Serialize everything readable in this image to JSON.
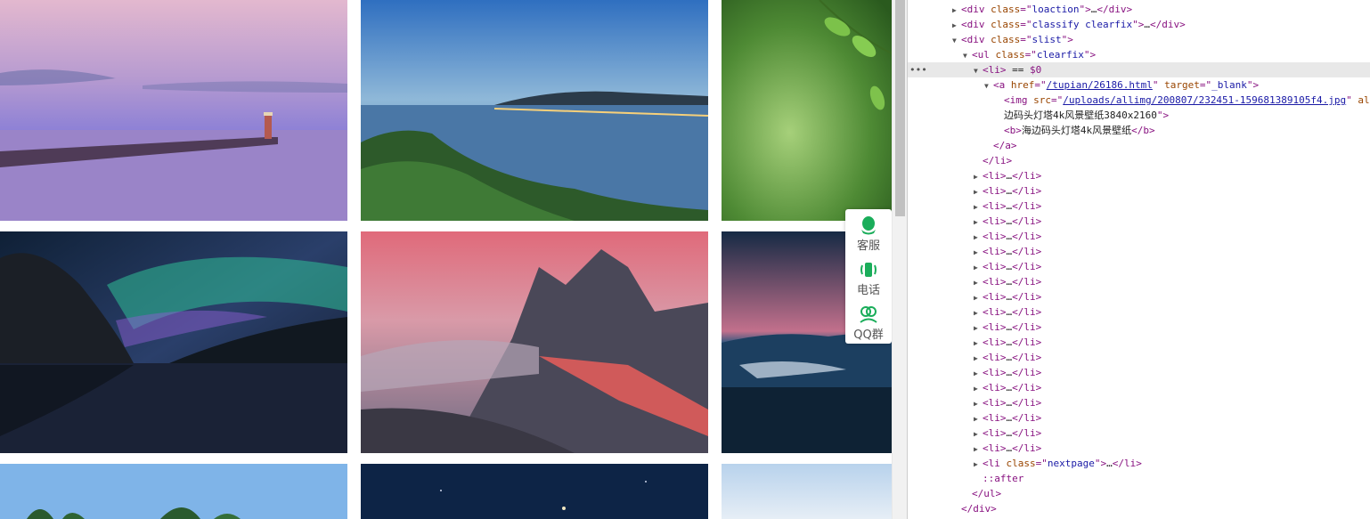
{
  "floating_panel": {
    "items": [
      {
        "label": "客服",
        "icon": "qq-penguin-icon"
      },
      {
        "label": "电话",
        "icon": "phone-icon"
      },
      {
        "label": "QQ群",
        "icon": "qq-group-icon"
      }
    ],
    "accent": "#1aad5a"
  },
  "devtools": {
    "lines": [
      {
        "indent": 4,
        "tri": "▶",
        "parts": [
          [
            "tg",
            "<div "
          ],
          [
            "an",
            "class"
          ],
          [
            "tg",
            "=\""
          ],
          [
            "av",
            "loaction"
          ],
          [
            "tg",
            "\">"
          ],
          [
            "tx",
            "…"
          ],
          [
            "tg",
            "</div>"
          ]
        ]
      },
      {
        "indent": 4,
        "tri": "▶",
        "parts": [
          [
            "tg",
            "<div "
          ],
          [
            "an",
            "class"
          ],
          [
            "tg",
            "=\""
          ],
          [
            "av",
            "classify clearfix"
          ],
          [
            "tg",
            "\">"
          ],
          [
            "tx",
            "…"
          ],
          [
            "tg",
            "</div>"
          ]
        ]
      },
      {
        "indent": 4,
        "tri": "▼",
        "parts": [
          [
            "tg",
            "<div "
          ],
          [
            "an",
            "class"
          ],
          [
            "tg",
            "=\""
          ],
          [
            "av",
            "slist"
          ],
          [
            "tg",
            "\">"
          ]
        ]
      },
      {
        "indent": 5,
        "tri": "▼",
        "parts": [
          [
            "tg",
            "<ul "
          ],
          [
            "an",
            "class"
          ],
          [
            "tg",
            "=\""
          ],
          [
            "av",
            "clearfix"
          ],
          [
            "tg",
            "\">"
          ]
        ]
      },
      {
        "indent": 6,
        "tri": "▼",
        "sel": true,
        "parts": [
          [
            "tg",
            "<li>"
          ],
          [
            "tx",
            " == "
          ],
          [
            "ps",
            "$0"
          ]
        ]
      },
      {
        "indent": 7,
        "tri": "▼",
        "parts": [
          [
            "tg",
            "<a "
          ],
          [
            "an",
            "href"
          ],
          [
            "tg",
            "=\""
          ],
          [
            "lk",
            "/tupian/26186.html"
          ],
          [
            "tg",
            "\" "
          ],
          [
            "an",
            "target"
          ],
          [
            "tg",
            "=\""
          ],
          [
            "av",
            "_blank"
          ],
          [
            "tg",
            "\">"
          ]
        ]
      },
      {
        "indent": 8,
        "tri": "",
        "parts": [
          [
            "tg",
            "<img "
          ],
          [
            "an",
            "src"
          ],
          [
            "tg",
            "=\""
          ],
          [
            "lk",
            "/uploads/allimg/200807/232451-159681389105f4.jpg"
          ],
          [
            "tg",
            "\" "
          ],
          [
            "an",
            "al"
          ]
        ]
      },
      {
        "indent": 8,
        "tri": "",
        "parts": [
          [
            "tx",
            "边码头灯塔4k风景壁纸3840x2160"
          ],
          [
            "tg",
            "\">"
          ]
        ]
      },
      {
        "indent": 8,
        "tri": "",
        "parts": [
          [
            "tg",
            "<b>"
          ],
          [
            "tx",
            "海边码头灯塔4k风景壁纸"
          ],
          [
            "tg",
            "</b>"
          ]
        ]
      },
      {
        "indent": 7,
        "tri": "",
        "parts": [
          [
            "tg",
            "</a>"
          ]
        ]
      },
      {
        "indent": 6,
        "tri": "",
        "parts": [
          [
            "tg",
            "</li>"
          ]
        ]
      },
      {
        "indent": 6,
        "tri": "▶",
        "parts": [
          [
            "tg",
            "<li>"
          ],
          [
            "tx",
            "…"
          ],
          [
            "tg",
            "</li>"
          ]
        ]
      },
      {
        "indent": 6,
        "tri": "▶",
        "parts": [
          [
            "tg",
            "<li>"
          ],
          [
            "tx",
            "…"
          ],
          [
            "tg",
            "</li>"
          ]
        ]
      },
      {
        "indent": 6,
        "tri": "▶",
        "parts": [
          [
            "tg",
            "<li>"
          ],
          [
            "tx",
            "…"
          ],
          [
            "tg",
            "</li>"
          ]
        ]
      },
      {
        "indent": 6,
        "tri": "▶",
        "parts": [
          [
            "tg",
            "<li>"
          ],
          [
            "tx",
            "…"
          ],
          [
            "tg",
            "</li>"
          ]
        ]
      },
      {
        "indent": 6,
        "tri": "▶",
        "parts": [
          [
            "tg",
            "<li>"
          ],
          [
            "tx",
            "…"
          ],
          [
            "tg",
            "</li>"
          ]
        ]
      },
      {
        "indent": 6,
        "tri": "▶",
        "parts": [
          [
            "tg",
            "<li>"
          ],
          [
            "tx",
            "…"
          ],
          [
            "tg",
            "</li>"
          ]
        ]
      },
      {
        "indent": 6,
        "tri": "▶",
        "parts": [
          [
            "tg",
            "<li>"
          ],
          [
            "tx",
            "…"
          ],
          [
            "tg",
            "</li>"
          ]
        ]
      },
      {
        "indent": 6,
        "tri": "▶",
        "parts": [
          [
            "tg",
            "<li>"
          ],
          [
            "tx",
            "…"
          ],
          [
            "tg",
            "</li>"
          ]
        ]
      },
      {
        "indent": 6,
        "tri": "▶",
        "parts": [
          [
            "tg",
            "<li>"
          ],
          [
            "tx",
            "…"
          ],
          [
            "tg",
            "</li>"
          ]
        ]
      },
      {
        "indent": 6,
        "tri": "▶",
        "parts": [
          [
            "tg",
            "<li>"
          ],
          [
            "tx",
            "…"
          ],
          [
            "tg",
            "</li>"
          ]
        ]
      },
      {
        "indent": 6,
        "tri": "▶",
        "parts": [
          [
            "tg",
            "<li>"
          ],
          [
            "tx",
            "…"
          ],
          [
            "tg",
            "</li>"
          ]
        ]
      },
      {
        "indent": 6,
        "tri": "▶",
        "parts": [
          [
            "tg",
            "<li>"
          ],
          [
            "tx",
            "…"
          ],
          [
            "tg",
            "</li>"
          ]
        ]
      },
      {
        "indent": 6,
        "tri": "▶",
        "parts": [
          [
            "tg",
            "<li>"
          ],
          [
            "tx",
            "…"
          ],
          [
            "tg",
            "</li>"
          ]
        ]
      },
      {
        "indent": 6,
        "tri": "▶",
        "parts": [
          [
            "tg",
            "<li>"
          ],
          [
            "tx",
            "…"
          ],
          [
            "tg",
            "</li>"
          ]
        ]
      },
      {
        "indent": 6,
        "tri": "▶",
        "parts": [
          [
            "tg",
            "<li>"
          ],
          [
            "tx",
            "…"
          ],
          [
            "tg",
            "</li>"
          ]
        ]
      },
      {
        "indent": 6,
        "tri": "▶",
        "parts": [
          [
            "tg",
            "<li>"
          ],
          [
            "tx",
            "…"
          ],
          [
            "tg",
            "</li>"
          ]
        ]
      },
      {
        "indent": 6,
        "tri": "▶",
        "parts": [
          [
            "tg",
            "<li>"
          ],
          [
            "tx",
            "…"
          ],
          [
            "tg",
            "</li>"
          ]
        ]
      },
      {
        "indent": 6,
        "tri": "▶",
        "parts": [
          [
            "tg",
            "<li>"
          ],
          [
            "tx",
            "…"
          ],
          [
            "tg",
            "</li>"
          ]
        ]
      },
      {
        "indent": 6,
        "tri": "▶",
        "parts": [
          [
            "tg",
            "<li>"
          ],
          [
            "tx",
            "…"
          ],
          [
            "tg",
            "</li>"
          ]
        ]
      },
      {
        "indent": 6,
        "tri": "▶",
        "parts": [
          [
            "tg",
            "<li "
          ],
          [
            "an",
            "class"
          ],
          [
            "tg",
            "=\""
          ],
          [
            "av",
            "nextpage"
          ],
          [
            "tg",
            "\">"
          ],
          [
            "tx",
            "…"
          ],
          [
            "tg",
            "</li>"
          ]
        ]
      },
      {
        "indent": 6,
        "tri": "",
        "parts": [
          [
            "ps",
            "::after"
          ]
        ]
      },
      {
        "indent": 5,
        "tri": "",
        "parts": [
          [
            "tg",
            "</ul>"
          ]
        ]
      },
      {
        "indent": 4,
        "tri": "",
        "parts": [
          [
            "tg",
            "</div>"
          ]
        ]
      }
    ]
  }
}
